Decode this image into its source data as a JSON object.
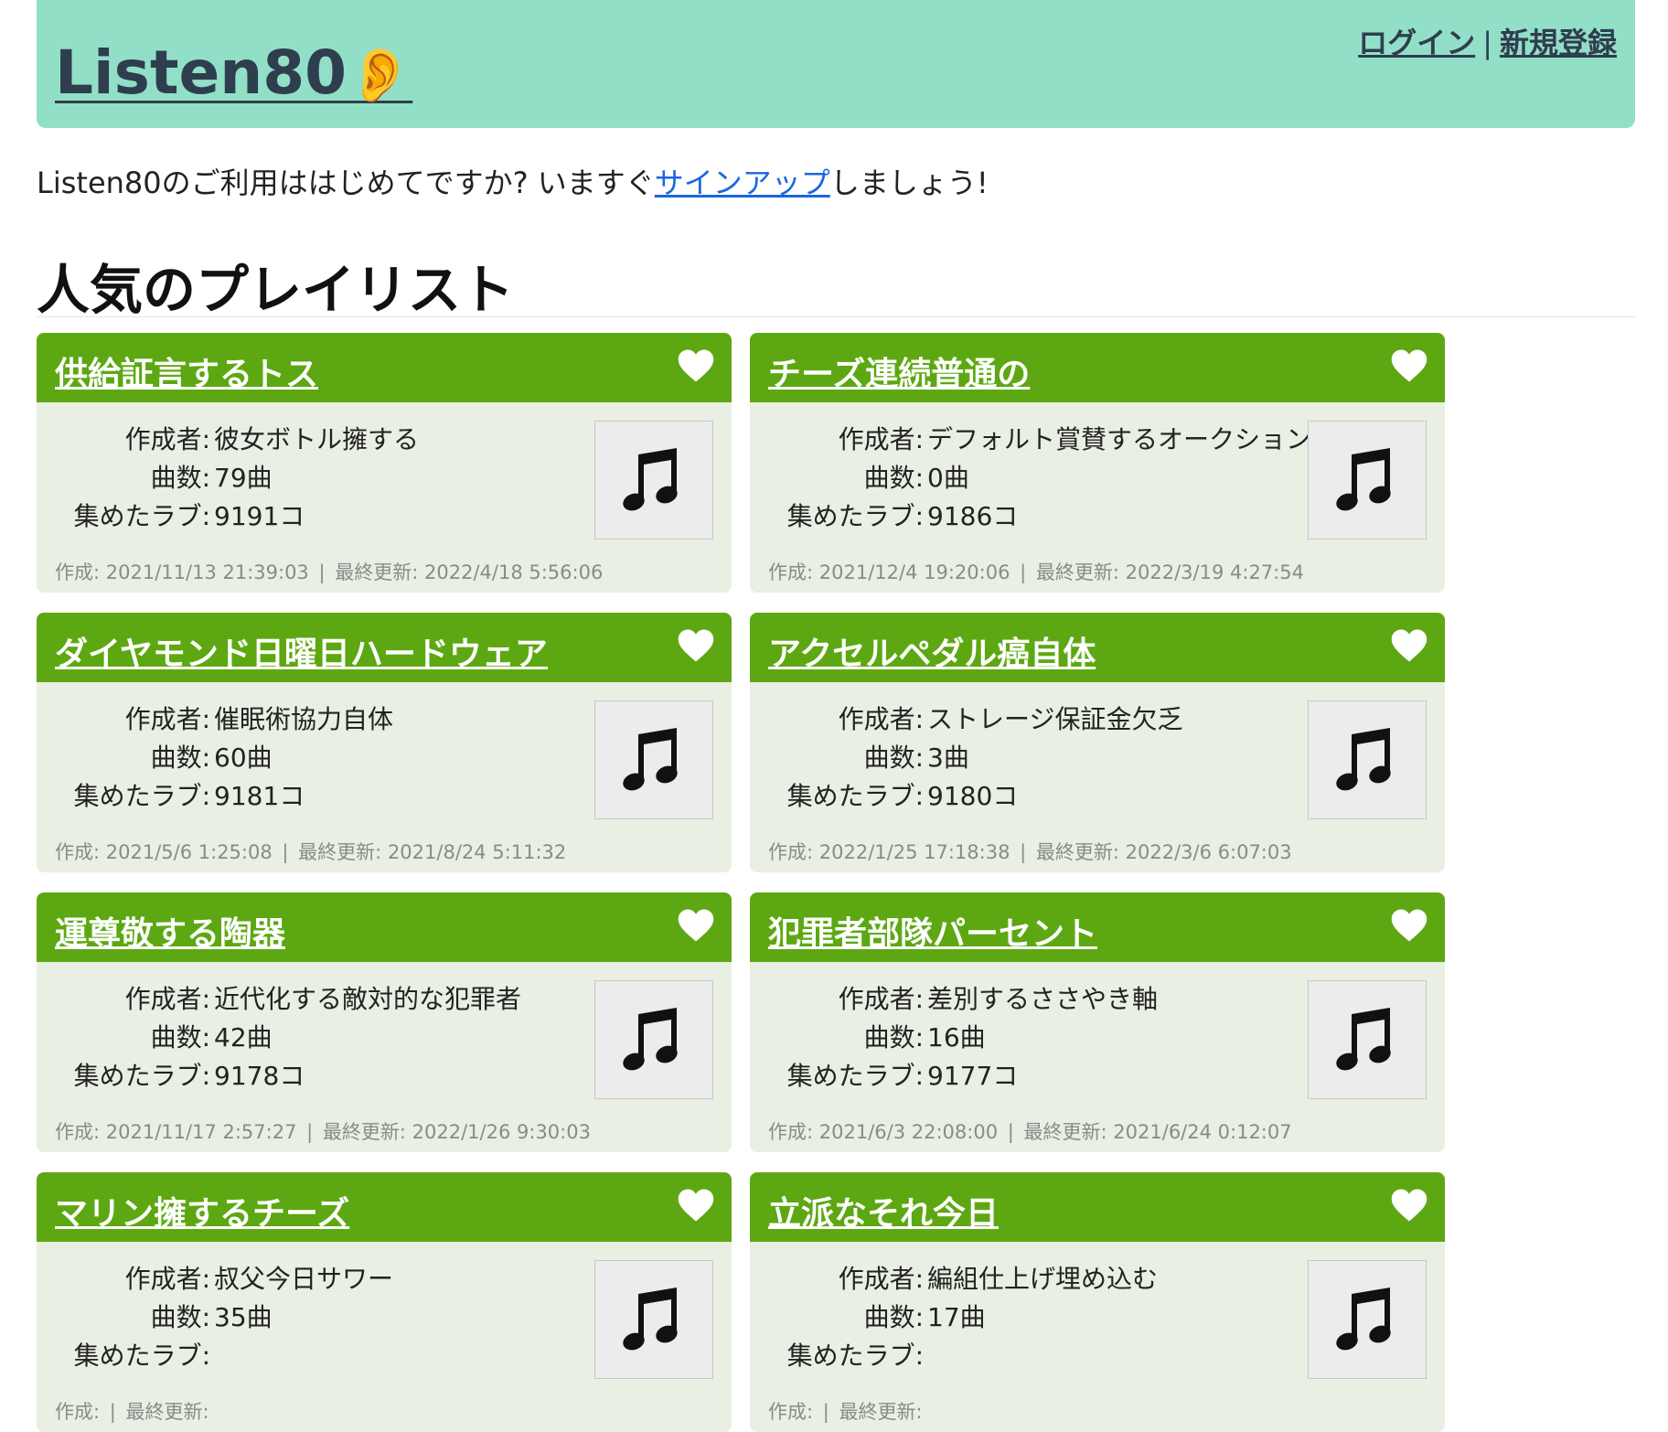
{
  "header": {
    "logo_text": "Listen80",
    "logo_emoji": "👂",
    "login_label": "ログイン",
    "separator": "|",
    "signup_label": "新規登録"
  },
  "intro": {
    "before": "Listen80のご利用ははじめてですか? いますぐ",
    "link": "サインアップ",
    "after": "しましょう!"
  },
  "section_title": "人気のプレイリスト",
  "labels": {
    "creator": "作成者:",
    "tracks": "曲数:",
    "loves": "集めたラブ:",
    "created": "作成:",
    "updated": "最終更新:",
    "meta_sep": "|"
  },
  "icons": {
    "like": "heart-icon",
    "thumbnail": "music-note-icon"
  },
  "colors": {
    "header_bg": "#92dfc8",
    "card_head": "#5da812",
    "card_body": "#e9efe2",
    "link": "#1a66e0"
  },
  "playlists": [
    {
      "title": "供給証言するトス",
      "creator": "彼女ボトル擁する",
      "tracks": "79曲",
      "loves": "9191コ",
      "created": "2021/11/13 21:39:03",
      "updated": "2022/4/18 5:56:06"
    },
    {
      "title": "チーズ連続普通の",
      "creator": "デフォルト賞賛するオークション",
      "tracks": "0曲",
      "loves": "9186コ",
      "created": "2021/12/4 19:20:06",
      "updated": "2022/3/19 4:27:54"
    },
    {
      "title": "ダイヤモンド日曜日ハードウェア",
      "creator": "催眠術協力自体",
      "tracks": "60曲",
      "loves": "9181コ",
      "created": "2021/5/6 1:25:08",
      "updated": "2021/8/24 5:11:32"
    },
    {
      "title": "アクセルペダル癌自体",
      "creator": "ストレージ保証金欠乏",
      "tracks": "3曲",
      "loves": "9180コ",
      "created": "2022/1/25 17:18:38",
      "updated": "2022/3/6 6:07:03"
    },
    {
      "title": "運尊敬する陶器",
      "creator": "近代化する敵対的な犯罪者",
      "tracks": "42曲",
      "loves": "9178コ",
      "created": "2021/11/17 2:57:27",
      "updated": "2022/1/26 9:30:03"
    },
    {
      "title": "犯罪者部隊パーセント",
      "creator": "差別するささやき軸",
      "tracks": "16曲",
      "loves": "9177コ",
      "created": "2021/6/3 22:08:00",
      "updated": "2021/6/24 0:12:07"
    },
    {
      "title": "マリン擁するチーズ",
      "creator": "叔父今日サワー",
      "tracks": "35曲",
      "loves": "",
      "created": "",
      "updated": ""
    },
    {
      "title": "立派なそれ今日",
      "creator": "編組仕上げ埋め込む",
      "tracks": "17曲",
      "loves": "",
      "created": "",
      "updated": ""
    }
  ]
}
